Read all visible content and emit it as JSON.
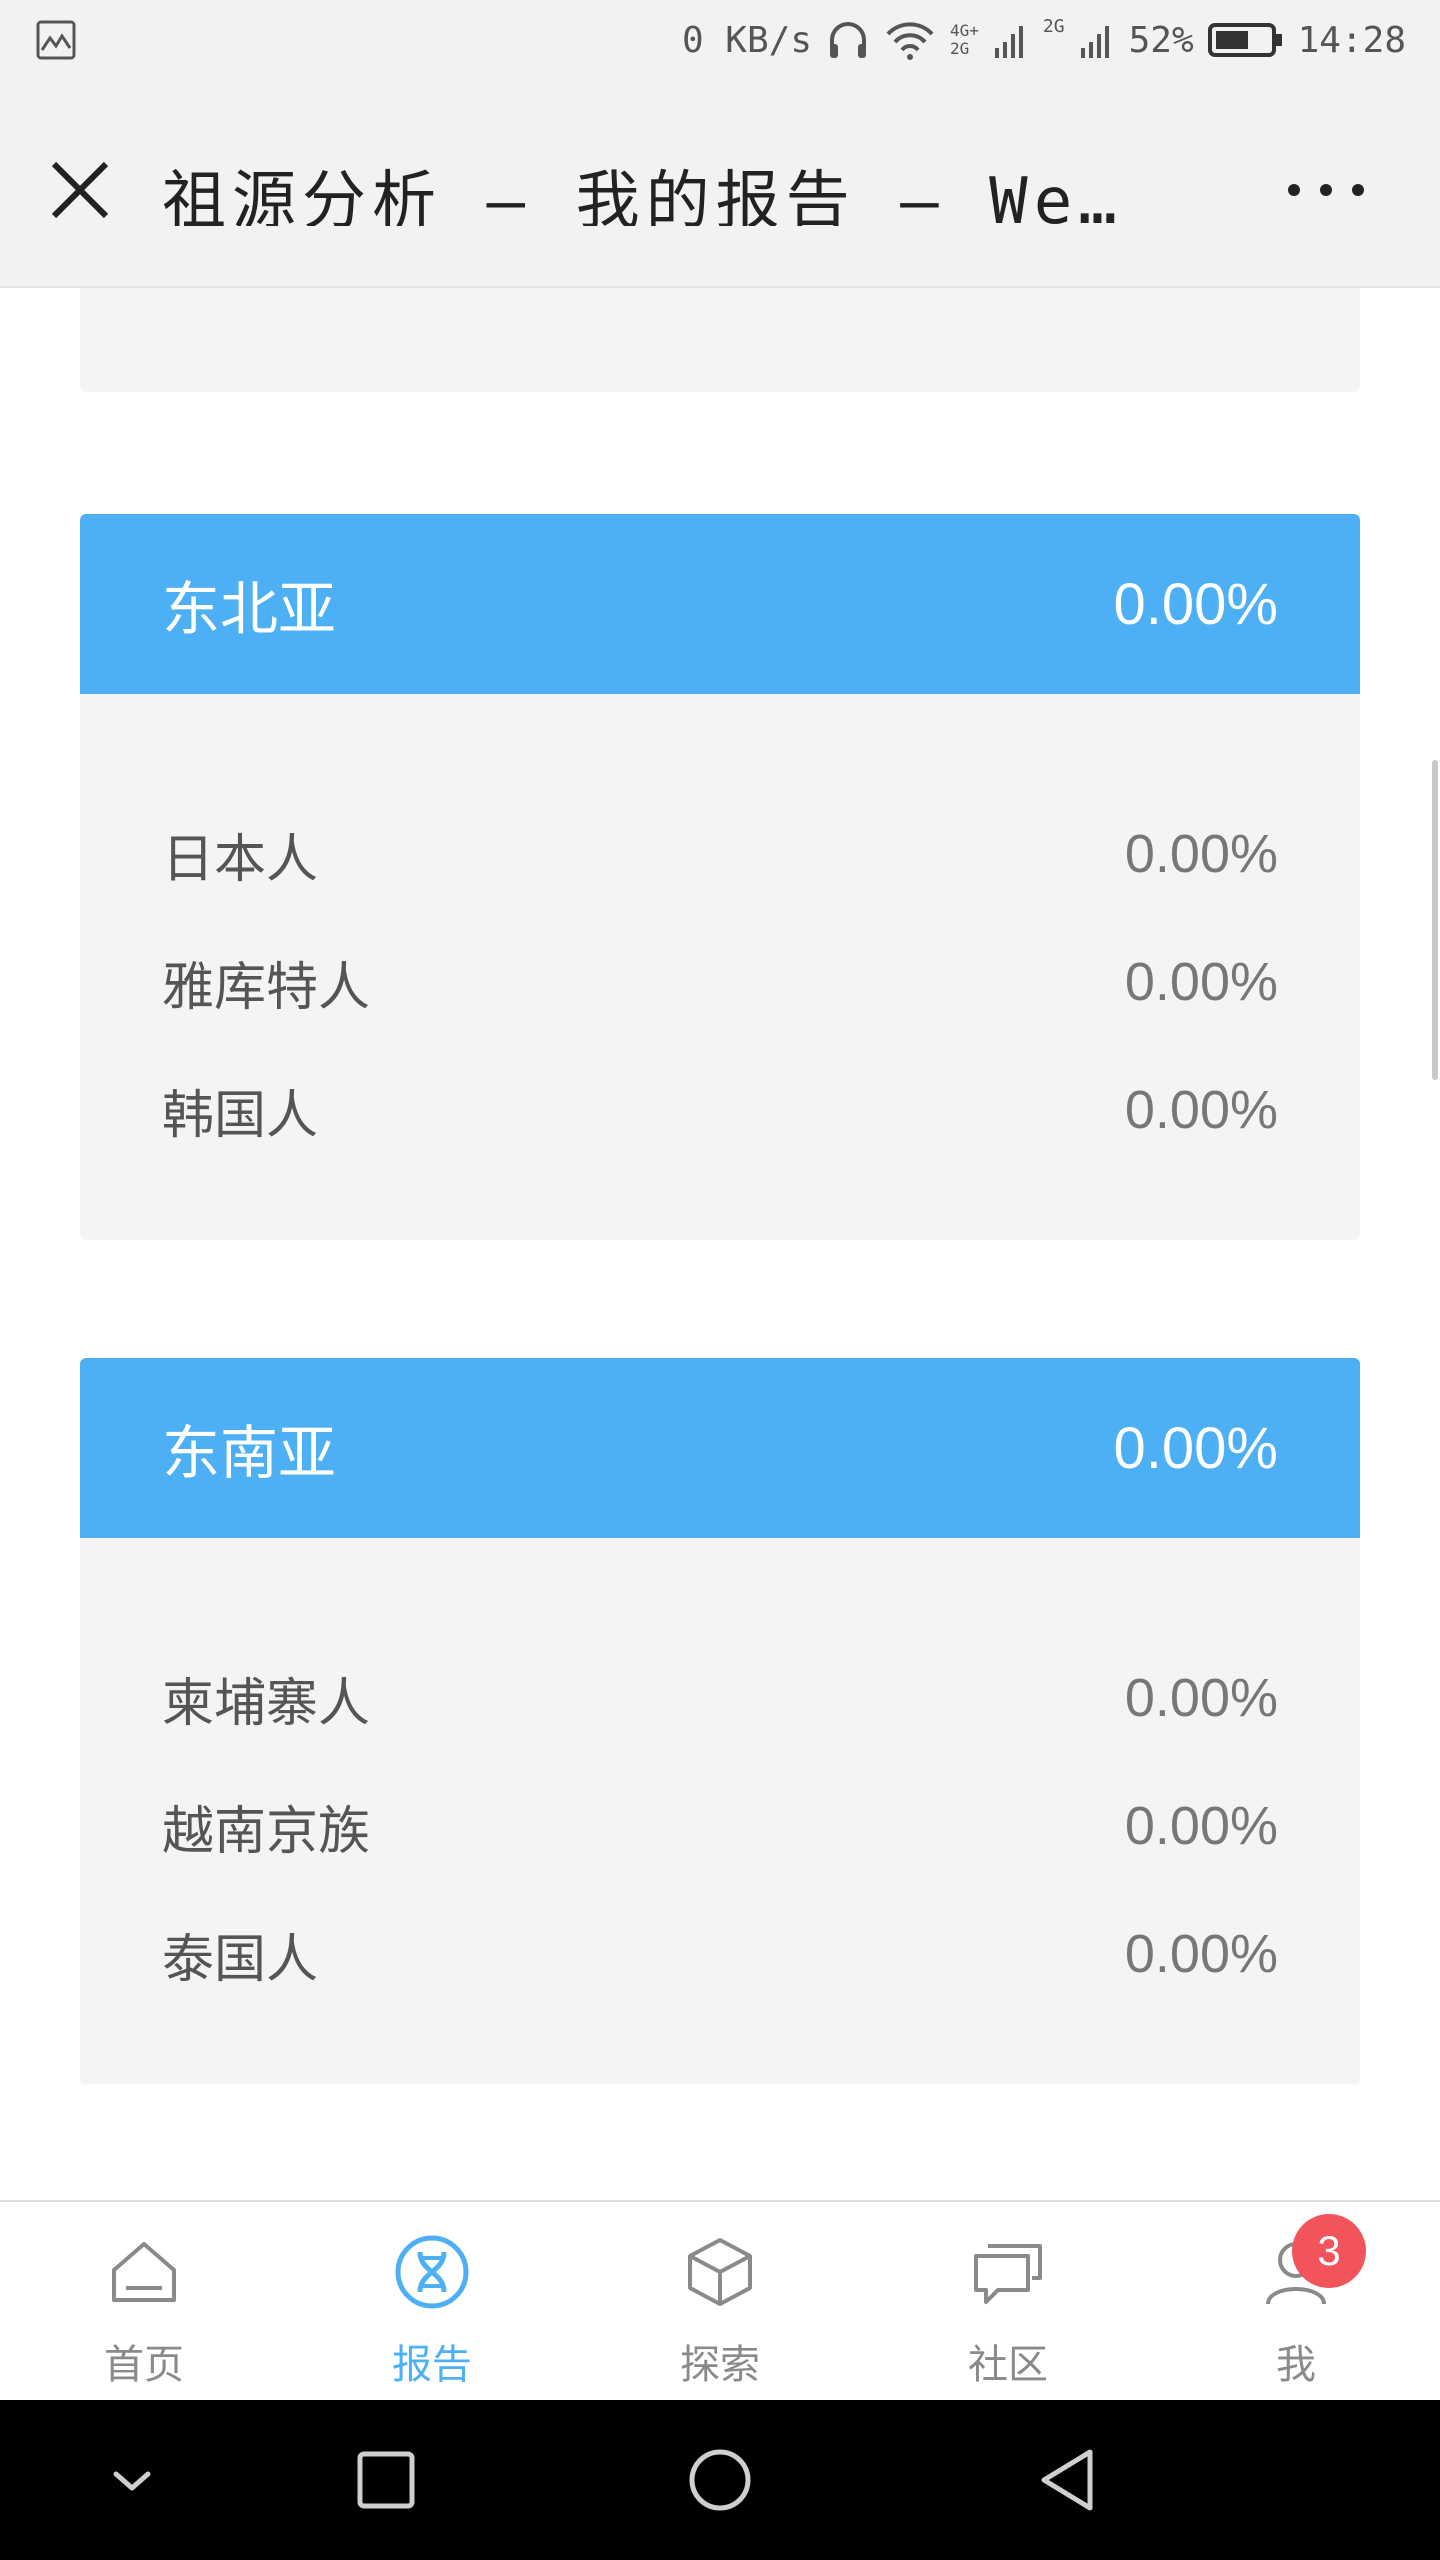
{
  "status_bar": {
    "speed": "0 KB/s",
    "net_top": "4G+",
    "net_bottom": "2G",
    "net2": "2G",
    "battery": "52%",
    "time": "14:28"
  },
  "titlebar": {
    "title": "祖源分析 — 我的报告 — We…"
  },
  "regions": [
    {
      "name": "东北亚",
      "percent": "0.00%",
      "items": [
        {
          "name": "日本人",
          "percent": "0.00%"
        },
        {
          "name": "雅库特人",
          "percent": "0.00%"
        },
        {
          "name": "韩国人",
          "percent": "0.00%"
        }
      ]
    },
    {
      "name": "东南亚",
      "percent": "0.00%",
      "items": [
        {
          "name": "柬埔寨人",
          "percent": "0.00%"
        },
        {
          "name": "越南京族",
          "percent": "0.00%"
        },
        {
          "name": "泰国人",
          "percent": "0.00%"
        }
      ]
    }
  ],
  "bottom_nav": {
    "items": [
      {
        "label": "首页",
        "icon": "home-icon"
      },
      {
        "label": "报告",
        "icon": "dna-icon"
      },
      {
        "label": "探索",
        "icon": "cube-icon"
      },
      {
        "label": "社区",
        "icon": "chat-icon"
      },
      {
        "label": "我",
        "icon": "user-icon"
      }
    ],
    "active_index": 1,
    "badge": "3"
  },
  "colors": {
    "accent": "#4eb0f4",
    "badge": "#f2545b",
    "card_bg": "#f4f4f4"
  }
}
